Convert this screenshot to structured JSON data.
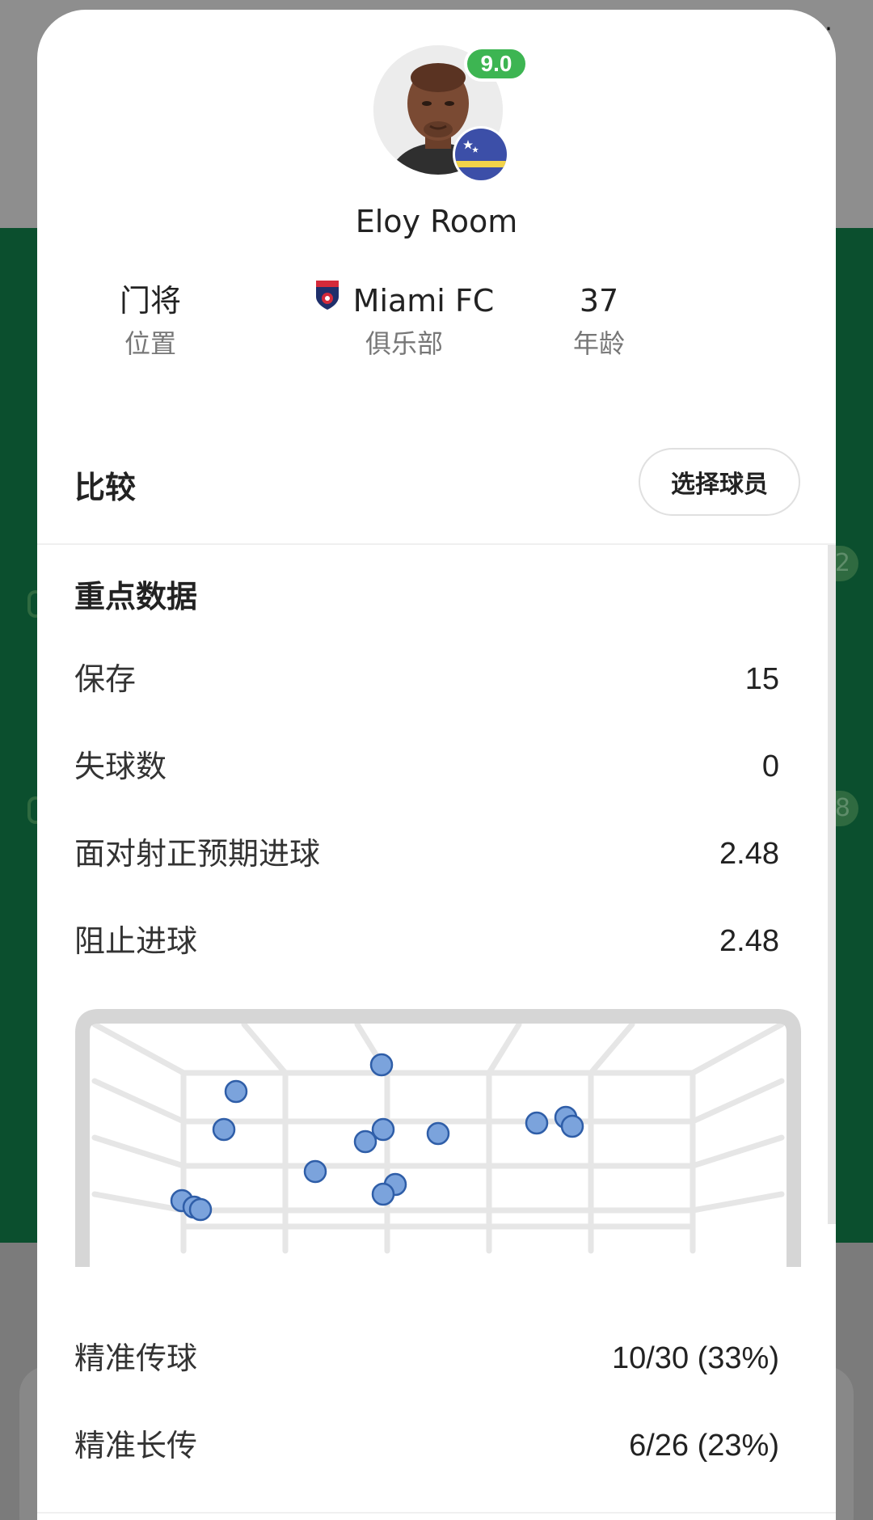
{
  "player": {
    "name": "Eloy Room",
    "rating": "9.0",
    "avatar_icon": "player-photo",
    "nationality_flag_icon": "curacao-flag"
  },
  "info": {
    "position": {
      "value": "门将",
      "label": "位置"
    },
    "club": {
      "value": "Miami FC",
      "label": "俱乐部",
      "logo_icon": "miami-fc-crest"
    },
    "age": {
      "value": "37",
      "label": "年龄"
    }
  },
  "compare": {
    "title": "比较",
    "select_button": "选择球员"
  },
  "key_stats": {
    "title": "重点数据",
    "rows": [
      {
        "label": "保存",
        "value": "15"
      },
      {
        "label": "失球数",
        "value": "0"
      },
      {
        "label": "面对射正预期进球",
        "value": "2.48"
      },
      {
        "label": "阻止进球",
        "value": "2.48"
      }
    ]
  },
  "passing": {
    "rows": [
      {
        "label": "精准传球",
        "value": "10/30 (33%)"
      },
      {
        "label": "精准长传",
        "value": "6/26 (23%)"
      }
    ]
  },
  "colors": {
    "rating_badge": "#3db552",
    "shot_fill": "#7ba3dc",
    "shot_stroke": "#2f5ea8",
    "goal_frame": "#d6d6d6",
    "background_green": "#0b4f2e"
  },
  "goal_map": {
    "shot_count": 15
  }
}
